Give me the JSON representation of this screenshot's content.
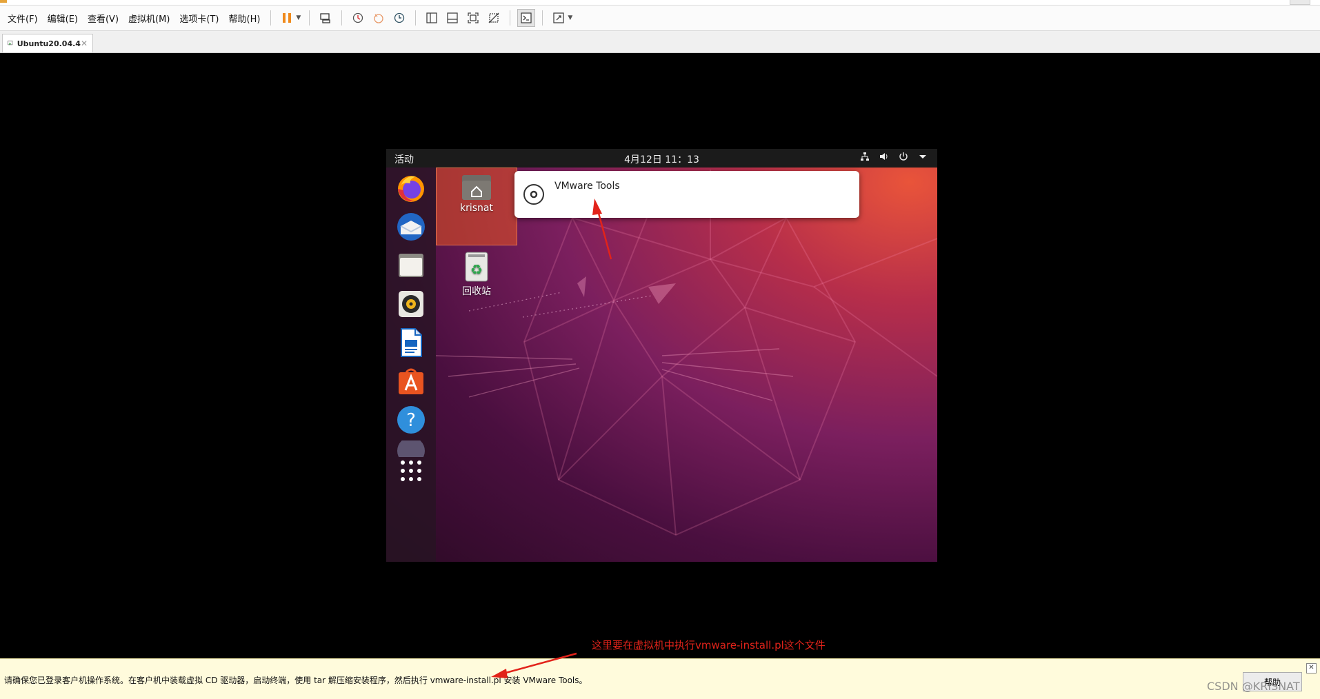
{
  "menubar": {
    "items": [
      "文件(F)",
      "编辑(E)",
      "查看(V)",
      "虚拟机(M)",
      "选项卡(T)",
      "帮助(H)"
    ],
    "toolbar_icons": [
      "pause-icon",
      "send-keys-icon",
      "snapshot-icon",
      "revert-snapshot-icon",
      "manage-snapshots-icon",
      "library-icon",
      "thumbnail-icon",
      "fullscreen-icon",
      "unity-icon",
      "console-icon",
      "stretch-icon"
    ]
  },
  "tab": {
    "label": "Ubuntu20.04.4"
  },
  "vm": {
    "activities": "活动",
    "clock": "4月12日  11：13",
    "desktop": {
      "home_label": "krisnat",
      "trash_label": "回收站"
    },
    "notification": {
      "title": "VMware Tools"
    },
    "dock_apps": [
      "firefox",
      "thunderbird",
      "files",
      "rhythmbox",
      "libreoffice-writer",
      "ubuntu-software",
      "help",
      "show-applications"
    ]
  },
  "annotation": {
    "text": "这里要在虚拟机中执行vmware-install.pl这个文件",
    "color": "#e2231a"
  },
  "hintbar": {
    "text": "请确保您已登录客户机操作系统。在客户机中装载虚拟 CD 驱动器，启动终端，使用 tar 解压缩安装程序，然后执行 vmware-install.pl 安装 VMware Tools。",
    "help_button": "帮助"
  },
  "watermark": "CSDN @KRISNAT"
}
